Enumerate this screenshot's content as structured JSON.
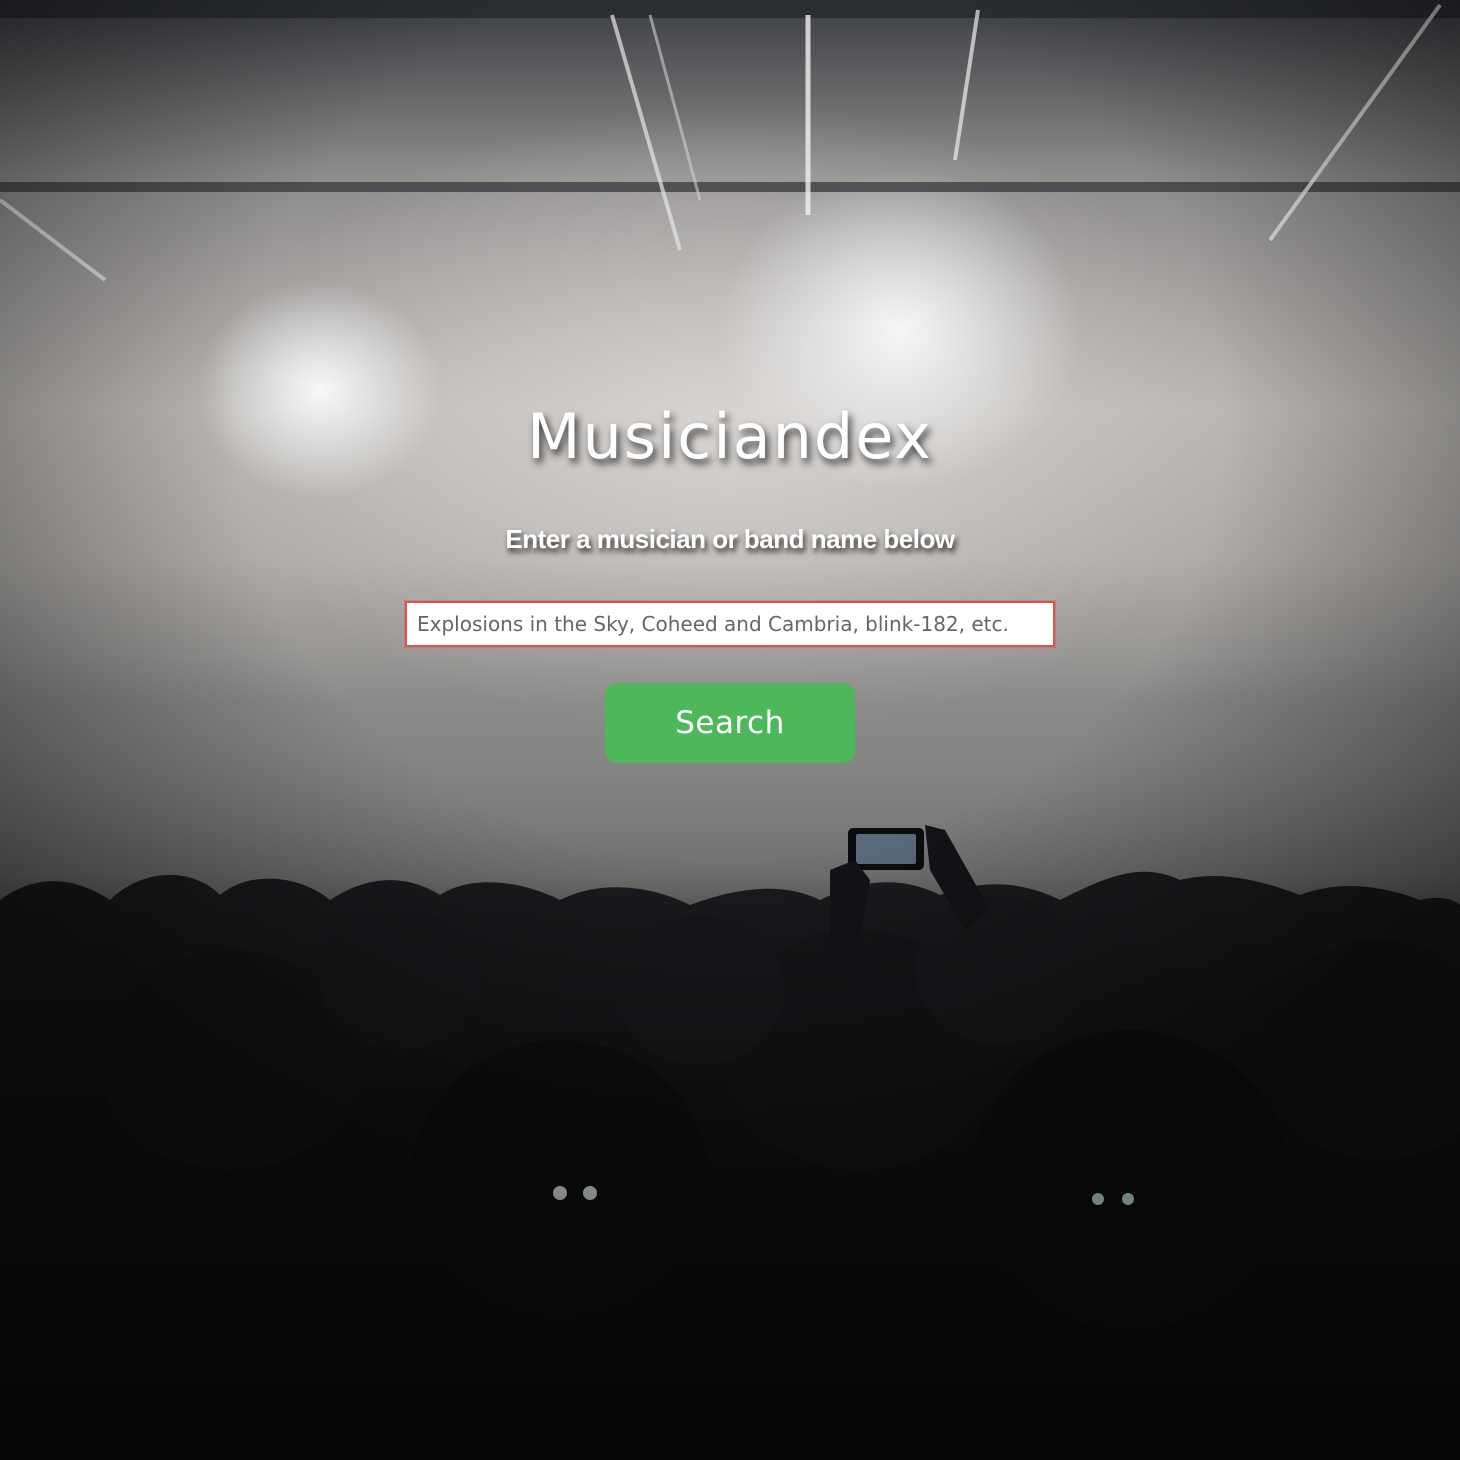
{
  "page": {
    "title": "Musiciandex",
    "subtitle": "Enter a musician or band name below"
  },
  "search": {
    "placeholder": "Explosions in the Sky, Coheed and Cambria, blink-182, etc.",
    "value": "",
    "button_label": "Search"
  },
  "colors": {
    "button_background": "#4cb85a",
    "input_border": "#d9534f",
    "text": "#ffffff"
  },
  "background": {
    "icon": "concert-crowd-background-image"
  }
}
